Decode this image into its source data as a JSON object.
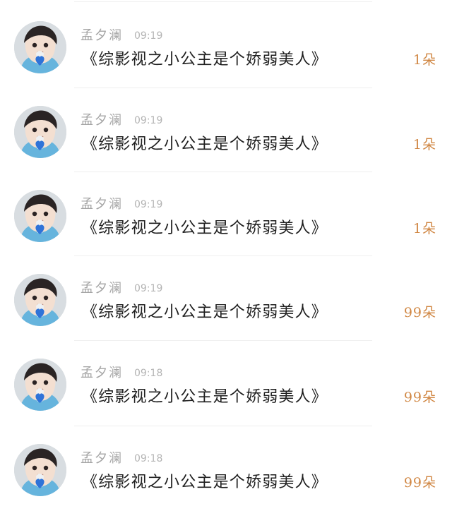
{
  "feed": {
    "items": [
      {
        "username": "孟夕澜",
        "time": "09:19",
        "content": "《综影视之小公主是个娇弱美人》",
        "gift_count": "1朵"
      },
      {
        "username": "孟夕澜",
        "time": "09:19",
        "content": "《综影视之小公主是个娇弱美人》",
        "gift_count": "1朵"
      },
      {
        "username": "孟夕澜",
        "time": "09:19",
        "content": "《综影视之小公主是个娇弱美人》",
        "gift_count": "1朵"
      },
      {
        "username": "孟夕澜",
        "time": "09:19",
        "content": "《综影视之小公主是个娇弱美人》",
        "gift_count": "99朵"
      },
      {
        "username": "孟夕澜",
        "time": "09:18",
        "content": "《综影视之小公主是个娇弱美人》",
        "gift_count": "99朵"
      },
      {
        "username": "孟夕澜",
        "time": "09:18",
        "content": "《综影视之小公主是个娇弱美人》",
        "gift_count": "99朵"
      }
    ]
  },
  "colors": {
    "username": "#a4a4a4",
    "time": "#b4b4b4",
    "content": "#1f1f1f",
    "gift_count": "#d08642",
    "divider": "#efefef",
    "heart": "#2f73d8"
  },
  "icons": {
    "avatar": "child-avatar-icon",
    "heart": "blue-heart-icon"
  }
}
